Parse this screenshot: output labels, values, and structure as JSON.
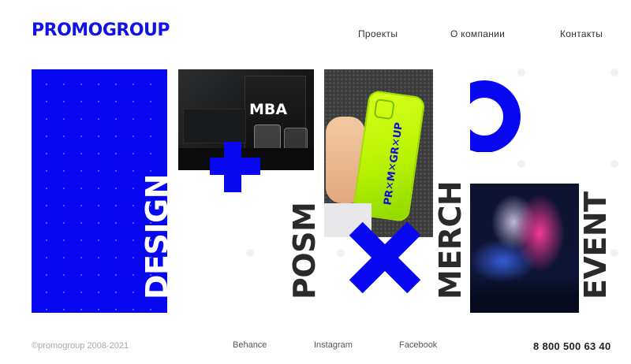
{
  "header": {
    "logo": "PROMOGROUP",
    "nav": [
      {
        "label": "Проекты"
      },
      {
        "label": "О компании"
      },
      {
        "label": "Контакты"
      }
    ]
  },
  "tiles": {
    "design": "DESIGN",
    "posm": "POSM",
    "merch": "MERCH",
    "event": "EVENT"
  },
  "photos": {
    "mba_text": "MBA",
    "case_text": "PR✕M✕GR✕UP"
  },
  "colors": {
    "brand": "#0808f0",
    "text": "#2a2a2a"
  },
  "footer": {
    "copyright": "©promogroup 2008-2021",
    "social": [
      "Behance",
      "Instagram",
      "Facebook"
    ],
    "phone": "8 800 500 63 40"
  }
}
